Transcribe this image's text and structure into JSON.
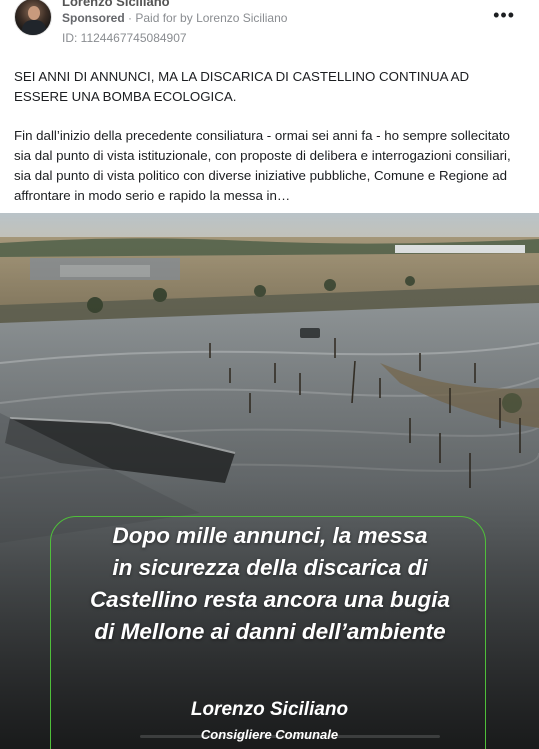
{
  "post": {
    "author": "Lorenzo Siciliano",
    "sponsored": "Sponsored",
    "paid_for_prefix": "· Paid for by",
    "paid_for_name": "Lorenzo Siciliano",
    "ad_id": "ID: 1124467745084907",
    "more_icon": "more-horizontal-icon",
    "headline_text": "SEI ANNI DI ANNUNCI, MA LA DISCARICA DI CASTELLINO CONTINUA AD ESSERE UNA BOMBA ECOLOGICA.",
    "body_text": "Fin dall’inizio della precedente consiliatura - ormai sei anni fa - ho sempre sollecitato sia dal punto di vista istituzionale, con proposte di delibera e interrogazioni consiliari, sia dal punto di vista politico con diverse iniziative pubbliche, Comune e Regione ad affrontare in modo serio e rapido la messa in…"
  },
  "media": {
    "overlay_lines": [
      "Dopo mille annunci, la messa",
      "in sicurezza della discarica di",
      "Castellino resta ancora una bugia",
      "di Mellone ai danni dell’ambiente"
    ],
    "signature_name": "Lorenzo Siciliano",
    "signature_role": "Consigliere Comunale",
    "accent_color": "#4fbf3a"
  }
}
